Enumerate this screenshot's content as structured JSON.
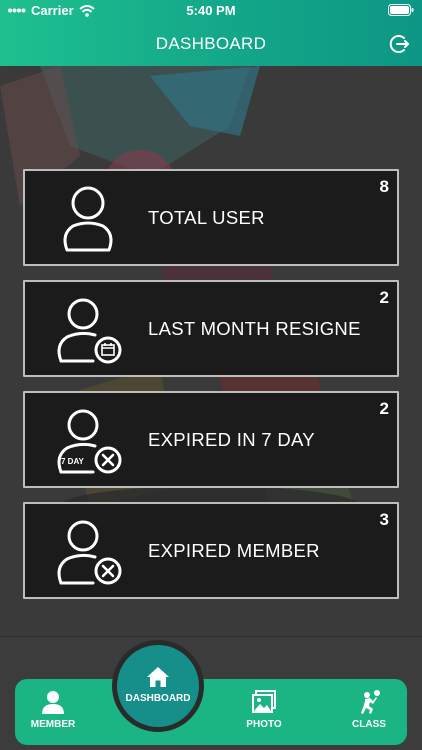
{
  "status_bar": {
    "carrier": "Carrier",
    "time": "5:40 PM"
  },
  "header": {
    "title": "DASHBOARD",
    "logout_icon": "logout-icon"
  },
  "cards": [
    {
      "label": "TOTAL USER",
      "count": "8",
      "icon": "user-icon"
    },
    {
      "label": "LAST MONTH RESIGNE",
      "count": "2",
      "icon": "user-calendar-icon"
    },
    {
      "label": "EXPIRED IN 7 DAY",
      "count": "2",
      "icon": "user-expired-7day-icon",
      "badge_text": "7 DAY"
    },
    {
      "label": "EXPIRED MEMBER",
      "count": "3",
      "icon": "user-expired-icon"
    }
  ],
  "tabs": [
    {
      "label": "MEMBER",
      "icon": "member-icon"
    },
    {
      "label": "DASHBOARD",
      "icon": "home-icon"
    },
    {
      "label": "PHOTO",
      "icon": "photo-icon"
    },
    {
      "label": "CLASS",
      "icon": "volleyball-player-icon"
    }
  ],
  "colors": {
    "accent": "#1bb585",
    "home_button": "#168e8a",
    "card_bg": "#1b1b1b",
    "background": "#3a3a3a"
  }
}
